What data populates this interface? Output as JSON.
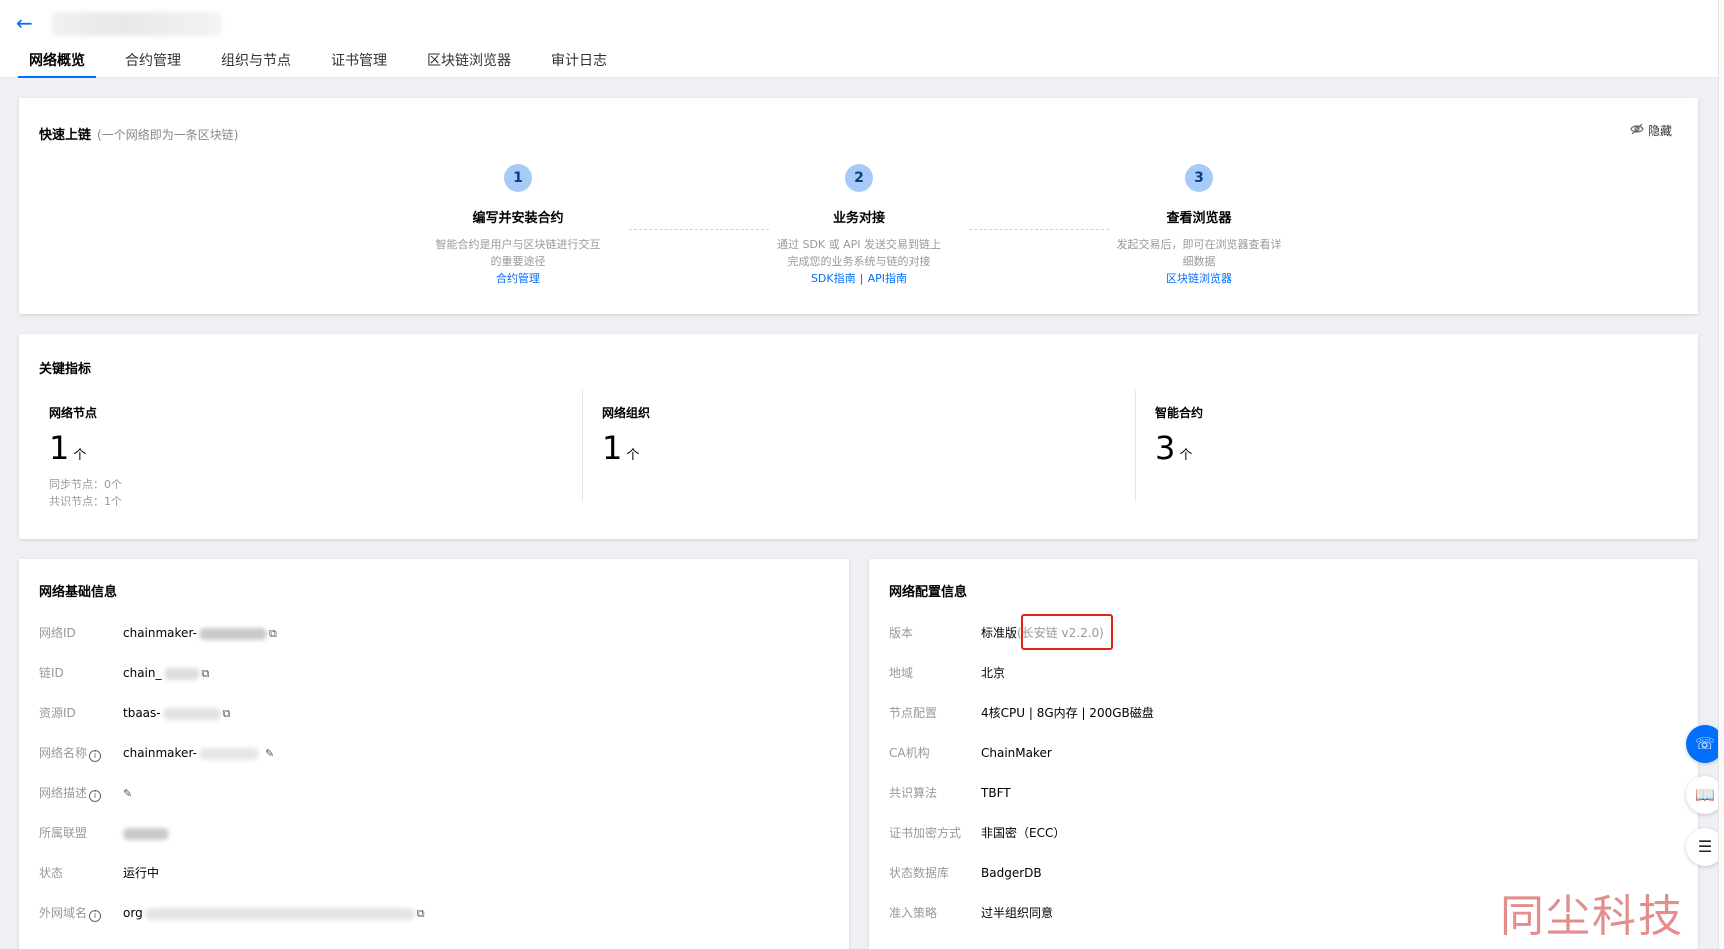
{
  "tabs": [
    "网络概览",
    "合约管理",
    "组织与节点",
    "证书管理",
    "区块链浏览器",
    "审计日志"
  ],
  "quick_start": {
    "title": "快速上链",
    "subtitle": "(一个网络即为一条区块链)",
    "hide_label": "隐藏",
    "steps": [
      {
        "num": "1",
        "title": "编写并安装合约",
        "desc1": "智能合约是用户与区块链进行交互",
        "desc2": "的重要途径",
        "links": [
          "合约管理"
        ]
      },
      {
        "num": "2",
        "title": "业务对接",
        "desc1": "通过 SDK 或 API 发送交易到链上",
        "desc2": "完成您的业务系统与链的对接",
        "links": [
          "SDK指南",
          "API指南"
        ]
      },
      {
        "num": "3",
        "title": "查看浏览器",
        "desc1": "发起交易后，即可在浏览器查看详",
        "desc2": "细数据",
        "links": [
          "区块链浏览器"
        ]
      }
    ],
    "link_separator": "|"
  },
  "metrics": {
    "title": "关键指标",
    "items": [
      {
        "label": "网络节点",
        "value": "1",
        "unit": "个",
        "subs": [
          "同步节点：0个",
          "共识节点：1个"
        ]
      },
      {
        "label": "网络组织",
        "value": "1",
        "unit": "个",
        "subs": []
      },
      {
        "label": "智能合约",
        "value": "3",
        "unit": "个",
        "subs": []
      }
    ]
  },
  "basic_info": {
    "title": "网络基础信息",
    "rows": [
      {
        "label": "网络ID",
        "value": "chainmaker-"
      },
      {
        "label": "链ID",
        "value": "chain_"
      },
      {
        "label": "资源ID",
        "value": "tbaas-"
      },
      {
        "label": "网络名称",
        "value": "chainmaker-"
      },
      {
        "label": "网络描述",
        "value": ""
      },
      {
        "label": "所属联盟",
        "value": ""
      },
      {
        "label": "状态",
        "value": "运行中"
      },
      {
        "label": "外网域名",
        "value": "org"
      }
    ]
  },
  "config_info": {
    "title": "网络配置信息",
    "rows": [
      {
        "label": "版本",
        "value": "标准版",
        "note": "(长安链 v2.2.0)"
      },
      {
        "label": "地域",
        "value": "北京"
      },
      {
        "label": "节点配置",
        "value": "4核CPU | 8G内存 | 200GB磁盘"
      },
      {
        "label": "CA机构",
        "value": "ChainMaker"
      },
      {
        "label": "共识算法",
        "value": "TBFT"
      },
      {
        "label": "证书加密方式",
        "value": "非国密（ECC）"
      },
      {
        "label": "状态数据库",
        "value": "BadgerDB"
      },
      {
        "label": "准入策略",
        "value": "过半组织同意"
      }
    ]
  },
  "watermark": "同尘科技",
  "colors": {
    "accent": "#006eff",
    "highlight": "#e2231a",
    "step_circle": "#a6cbf8"
  }
}
